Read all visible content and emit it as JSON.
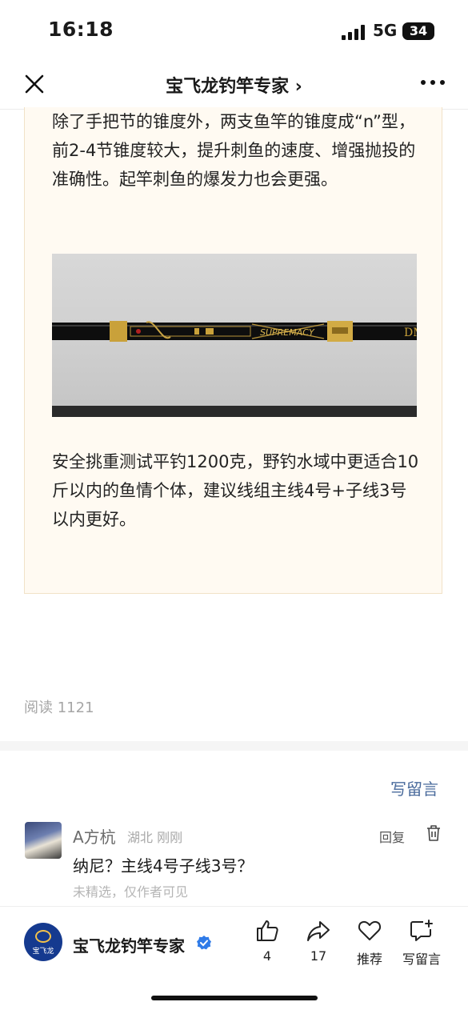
{
  "status_bar": {
    "time": "16:18",
    "network": "5G",
    "battery": "34"
  },
  "nav": {
    "title": "宝飞龙钓竿专家 ›"
  },
  "article": {
    "para1": "除了手把节的锥度外，两支鱼竿的锥度成“n”型，前2-4节锥度较大，提升刺鱼的速度、增强抛投的准确性。起竿刺鱼的爆发力也会更强。",
    "para2": "安全挑重测试平钓1200克，野钓水域中更适合10斤以内的鱼情个体，建议线组主线4号+子线3号以内更好。",
    "image_text": {
      "rod_brand": "SUPREMACY",
      "rod_end": "DM"
    }
  },
  "stats": {
    "reads": "阅读 1121"
  },
  "comments": {
    "write_label": "写留言",
    "items": [
      {
        "name": "A方杭",
        "meta": "湖北  刚刚",
        "reply_label": "回复",
        "text": "纳尼？主线4号子线3号？",
        "note": "未精选，仅作者可见"
      }
    ]
  },
  "bottom_bar": {
    "account_name": "宝飞龙钓竿专家",
    "logo_text": "宝飞龙",
    "like_count": "4",
    "share_count": "17",
    "recommend_label": "推荐",
    "comment_label": "写留言"
  },
  "colors": {
    "link": "#4a6b9c",
    "verify": "#2f7be8",
    "article_bg": "#fffaf2",
    "logo_bg": "#153a8f"
  }
}
